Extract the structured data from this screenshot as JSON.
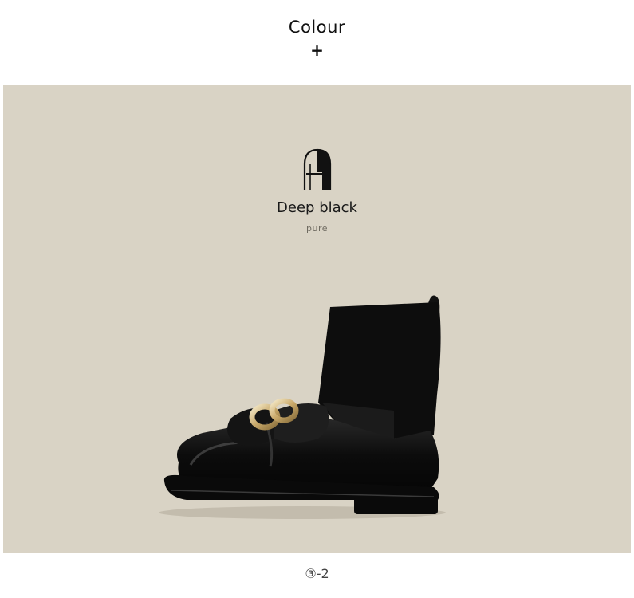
{
  "header": {
    "title": "Colour",
    "plus": "+"
  },
  "product": {
    "color_name": "Deep black",
    "color_sub": "pure",
    "image_icon": "ankle-boot-image",
    "logo_icon": "brand-arch-logo-icon",
    "panel_color": "#d9d3c5"
  },
  "footer": {
    "page_label": "③-2"
  }
}
